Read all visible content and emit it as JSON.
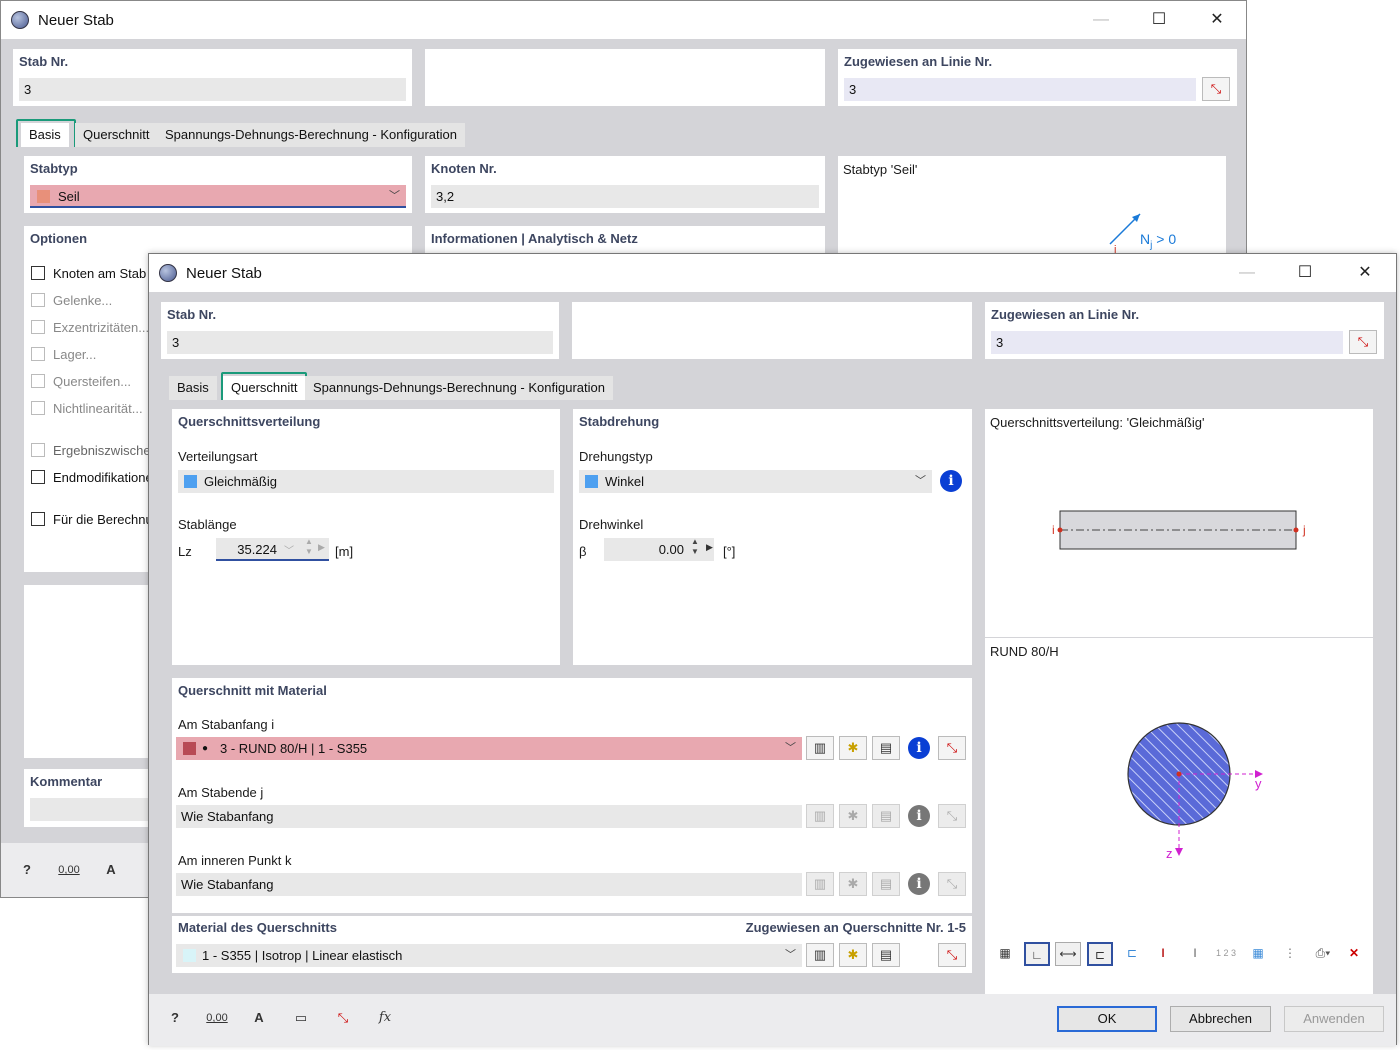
{
  "back_window": {
    "title": "Neuer Stab",
    "stab_nr_label": "Stab Nr.",
    "stab_nr_value": "3",
    "assigned_label": "Zugewiesen an Linie Nr.",
    "assigned_value": "3",
    "tabs": [
      "Basis",
      "Querschnitt",
      "Spannungs-Dehnungs-Berechnung - Konfiguration"
    ],
    "stabtyp_label": "Stabtyp",
    "stabtyp_value": "Seil",
    "stabtyp_color": "#e8907a",
    "knoten_label": "Knoten Nr.",
    "knoten_value": "3,2",
    "preview_label": "Stabtyp 'Seil'",
    "preview_force": "N",
    "preview_force_sub": "j",
    "preview_force_rel": " > 0",
    "preview_node": "i",
    "optionen_label": "Optionen",
    "info_label": "Informationen | Analytisch & Netz",
    "options": [
      {
        "label": "Knoten am Stab",
        "enabled": true
      },
      {
        "label": "Gelenke...",
        "enabled": false
      },
      {
        "label": "Exzentrizitäten...",
        "enabled": false
      },
      {
        "label": "Lager...",
        "enabled": false
      },
      {
        "label": "Quersteifen...",
        "enabled": false
      },
      {
        "label": "Nichtlinearität...",
        "enabled": false
      },
      {
        "label": "Ergebniszwische",
        "enabled": false
      },
      {
        "label": "Endmodifikatione",
        "enabled": true
      },
      {
        "label": "Für die Berechnu",
        "enabled": true
      }
    ],
    "kommentar_label": "Kommentar"
  },
  "front_window": {
    "title": "Neuer Stab",
    "stab_nr_label": "Stab Nr.",
    "stab_nr_value": "3",
    "assigned_label": "Zugewiesen an Linie Nr.",
    "assigned_value": "3",
    "tabs": [
      "Basis",
      "Querschnitt",
      "Spannungs-Dehnungs-Berechnung - Konfiguration"
    ],
    "active_tab": "Querschnitt",
    "qv": {
      "heading": "Querschnittsverteilung",
      "verteilungsart_label": "Verteilungsart",
      "verteilungsart_value": "Gleichmäßig",
      "stablaenge_label": "Stablänge",
      "lz_label": "Lz",
      "lz_value": "35.224",
      "lz_unit": "[m]"
    },
    "rot": {
      "heading": "Stabdrehung",
      "drehungstyp_label": "Drehungstyp",
      "drehungstyp_value": "Winkel",
      "drehwinkel_label": "Drehwinkel",
      "beta_label": "β",
      "beta_value": "0.00",
      "beta_unit": "[°]"
    },
    "qm": {
      "heading": "Querschnitt mit Material",
      "start_label": "Am Stabanfang i",
      "start_value": "3 - RUND 80/H | 1 - S355",
      "start_color": "#b84a55",
      "end_label": "Am Stabende j",
      "end_value": "Wie Stabanfang",
      "inner_label": "Am inneren Punkt k",
      "inner_value": "Wie Stabanfang"
    },
    "mat": {
      "heading": "Material des Querschnitts",
      "assigned": "Zugewiesen an Querschnitte Nr. 1-5",
      "value": "1 - S355 | Isotrop | Linear elastisch",
      "color": "#d8f4f8"
    },
    "preview": {
      "dist_label": "Querschnittsverteilung: 'Gleichmäßig'",
      "node_i": "i",
      "node_j": "j",
      "section_label": "RUND 80/H",
      "axis_y": "y",
      "axis_z": "z"
    },
    "buttons": {
      "ok": "OK",
      "cancel": "Abbrechen",
      "apply": "Anwenden"
    },
    "footer_icons": {
      "zero_label": "0,00"
    }
  },
  "colors": {
    "highlight": "#1a9a7a",
    "swatch_blue": "#4ea0f0",
    "info_blue": "#0a3fd4",
    "axis_magenta": "#d020d0",
    "node_red": "#d03020"
  }
}
